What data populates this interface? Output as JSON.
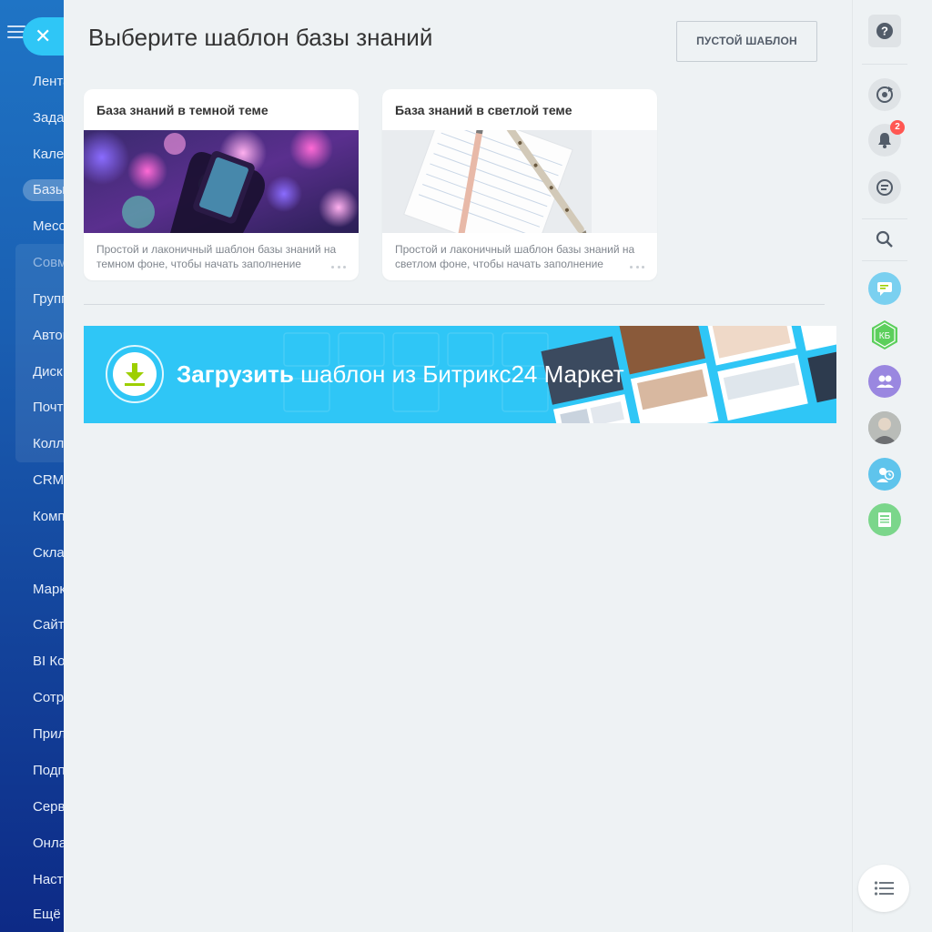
{
  "left_nav": {
    "items": [
      {
        "label": "Лента",
        "muted": false
      },
      {
        "label": "Задачи",
        "muted": false
      },
      {
        "label": "Календарь",
        "muted": false
      },
      {
        "label": "Базы знаний",
        "muted": false,
        "active": true
      },
      {
        "label": "Мессенджер",
        "muted": false
      },
      {
        "label": "Совместная работа",
        "muted": true
      },
      {
        "label": "Группы",
        "muted": false
      },
      {
        "label": "Автоматизация",
        "muted": false
      },
      {
        "label": "Диск",
        "muted": false
      },
      {
        "label": "Почта",
        "muted": false
      },
      {
        "label": "Коллеги",
        "muted": false
      },
      {
        "label": "CRM",
        "muted": false
      },
      {
        "label": "Компания",
        "muted": false
      },
      {
        "label": "Склад",
        "muted": false
      },
      {
        "label": "Маркетинг",
        "muted": false
      },
      {
        "label": "Сайты",
        "muted": false
      },
      {
        "label": "BI Конструктор",
        "muted": false
      },
      {
        "label": "Сотрудники",
        "muted": false
      },
      {
        "label": "Приложения",
        "muted": false
      },
      {
        "label": "Подписка",
        "muted": false
      },
      {
        "label": "Сервисы",
        "muted": false
      },
      {
        "label": "Онлайн-запись",
        "muted": false
      },
      {
        "label": "Настройки",
        "muted": false
      },
      {
        "label": "Ещё",
        "muted": false
      }
    ]
  },
  "slider": {
    "close_glyph": "✕",
    "title": "Выберите шаблон базы знаний",
    "empty_template_label": "ПУСТОЙ ШАБЛОН"
  },
  "cards": [
    {
      "title": "База знаний в темной теме",
      "description": "Простой и лаконичный шаблон базы знаний на темном фоне, чтобы начать заполнение",
      "theme": "dark"
    },
    {
      "title": "База знаний в светлой теме",
      "description": "Простой и лаконичный шаблон базы знаний на светлом фоне, чтобы начать заполнение",
      "theme": "light"
    }
  ],
  "banner": {
    "text_bold": "Загрузить",
    "text_rest": " шаблон из Битрикс24 Маркет"
  },
  "right_rail": {
    "help_glyph": "?",
    "notifications_count": "2",
    "kb_label": "КБ"
  },
  "colors": {
    "accent": "#2fc6f6",
    "download_green": "#9dcf00",
    "badge_red": "#ff5752"
  }
}
